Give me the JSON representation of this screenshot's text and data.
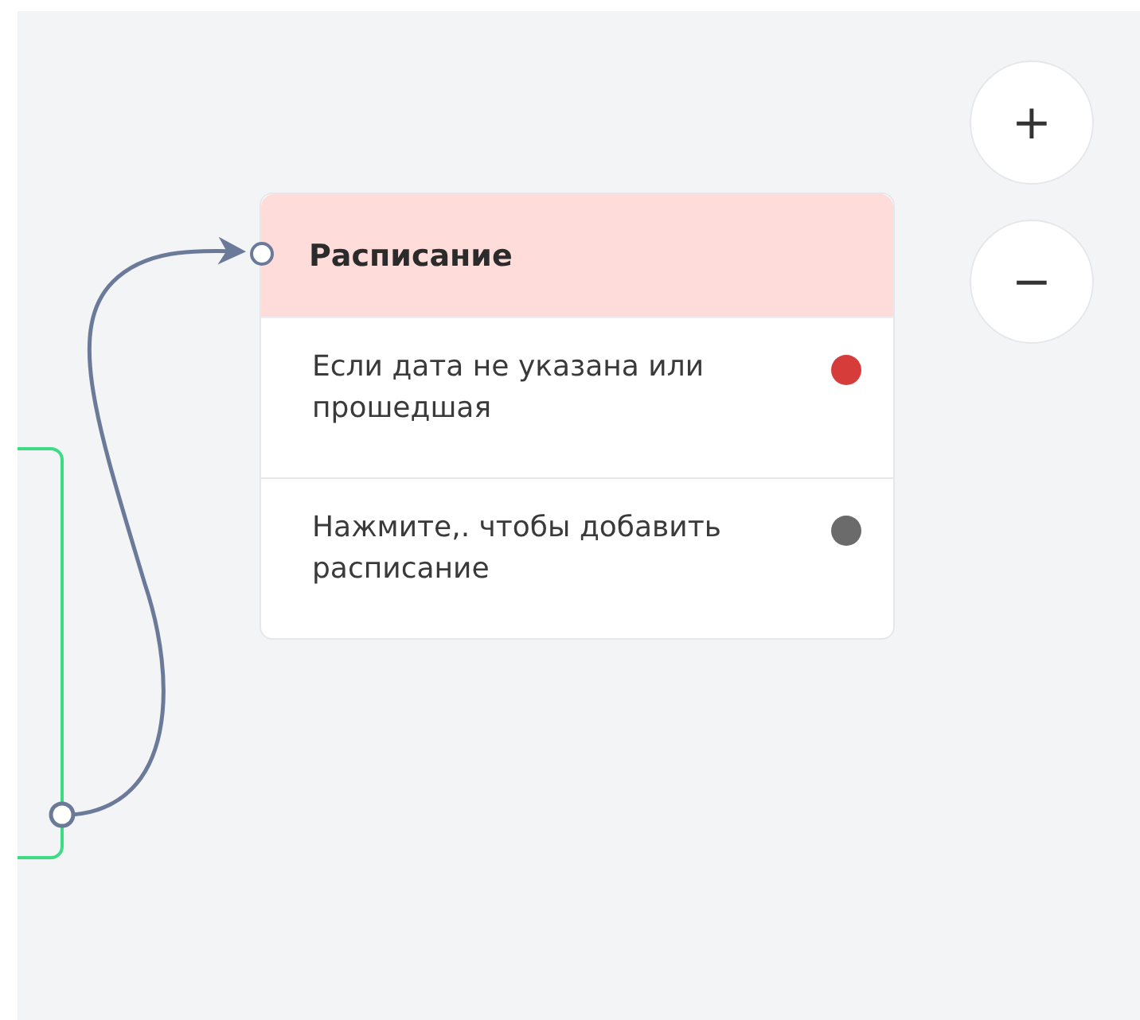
{
  "zoom_controls": [
    {
      "label": "+"
    },
    {
      "label": "−"
    }
  ],
  "node": {
    "title": "Расписание",
    "rows": [
      {
        "text": "Если дата не указана или прошедшая",
        "color": "#d63c3a"
      },
      {
        "text": "Нажмите,. чтобы добавить расписание",
        "color": "#6b6b6b"
      }
    ]
  }
}
